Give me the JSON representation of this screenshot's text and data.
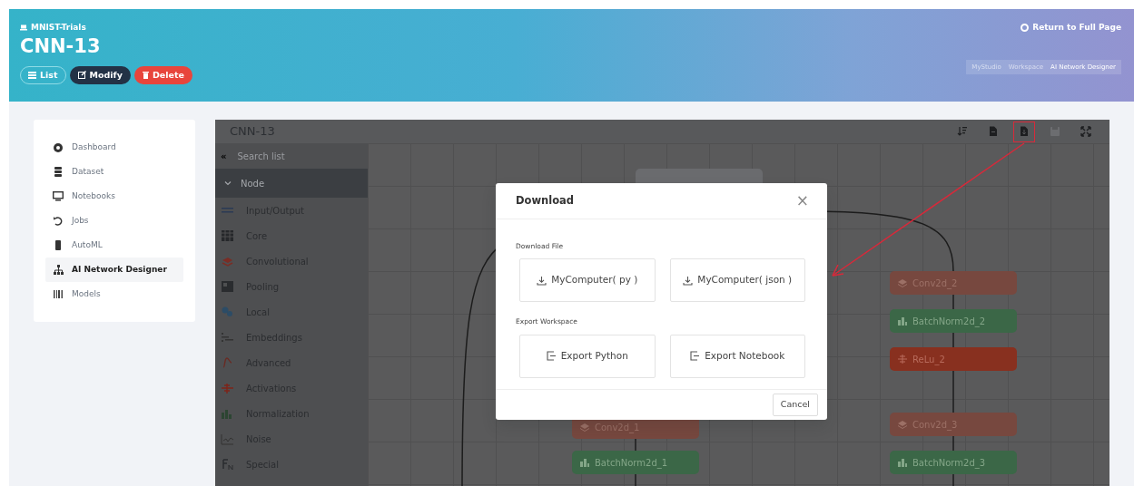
{
  "header": {
    "project": "MNIST-Trials",
    "title": "CNN-13",
    "buttons": [
      {
        "label": "List",
        "kind": "outline"
      },
      {
        "label": "Modify",
        "kind": "dark"
      },
      {
        "label": "Delete",
        "kind": "danger"
      }
    ],
    "return_link": "Return to Full Page",
    "breadcrumb": [
      {
        "label": "MyStudio",
        "active": false
      },
      {
        "label": "Workspace",
        "active": false
      },
      {
        "label": "AI Network Designer",
        "active": true
      }
    ]
  },
  "sidebar": {
    "items": [
      {
        "label": "Dashboard",
        "kind": "dashboard",
        "selected": false
      },
      {
        "label": "Dataset",
        "kind": "dataset",
        "selected": false
      },
      {
        "label": "Notebooks",
        "kind": "notebooks",
        "selected": false
      },
      {
        "label": "Jobs",
        "kind": "jobs",
        "selected": false
      },
      {
        "label": "AutoML",
        "kind": "automl",
        "selected": false
      },
      {
        "label": "AI Network Designer",
        "kind": "network",
        "selected": true
      },
      {
        "label": "Models",
        "kind": "models",
        "selected": false
      }
    ]
  },
  "editor": {
    "title": "CNN-13",
    "toolbar": [
      {
        "kind": "sort",
        "disabled": false,
        "annotated": false
      },
      {
        "kind": "file",
        "disabled": false,
        "annotated": false
      },
      {
        "kind": "download",
        "disabled": false,
        "annotated": true
      },
      {
        "kind": "save",
        "disabled": true,
        "annotated": false
      },
      {
        "kind": "fullscreen",
        "disabled": false,
        "annotated": false
      }
    ],
    "palette": {
      "collapse": "«",
      "search_placeholder": "Search list",
      "group": {
        "label": "Node",
        "expanded": true
      },
      "categories": [
        {
          "label": "Input/Output",
          "kind": "io"
        },
        {
          "label": "Core",
          "kind": "core"
        },
        {
          "label": "Convolutional",
          "kind": "conv"
        },
        {
          "label": "Pooling",
          "kind": "pool"
        },
        {
          "label": "Local",
          "kind": "local"
        },
        {
          "label": "Embeddings",
          "kind": "embed"
        },
        {
          "label": "Advanced",
          "kind": "advanced"
        },
        {
          "label": "Activations",
          "kind": "activation"
        },
        {
          "label": "Normalization",
          "kind": "norm"
        },
        {
          "label": "Noise",
          "kind": "noise"
        },
        {
          "label": "Special",
          "kind": "special"
        }
      ]
    },
    "graph": {
      "columns": [
        {
          "nodes": [
            {
              "label": "Conv2d_1",
              "kind": "conv"
            },
            {
              "label": "BatchNorm2d_1",
              "kind": "norm"
            }
          ]
        },
        {
          "nodes": [
            {
              "label": "Conv2d_2",
              "kind": "conv"
            },
            {
              "label": "BatchNorm2d_2",
              "kind": "norm"
            },
            {
              "label": "ReLu_2",
              "kind": "activation"
            },
            {
              "label": "Conv2d_3",
              "kind": "conv"
            },
            {
              "label": "BatchNorm2d_3",
              "kind": "norm"
            }
          ]
        }
      ]
    }
  },
  "dialog": {
    "title": "Download",
    "close": "×",
    "sections": [
      {
        "heading": "Download File",
        "options": [
          {
            "label": "MyComputer( py )",
            "kind": "download"
          },
          {
            "label": "MyComputer( json )",
            "kind": "download"
          }
        ]
      },
      {
        "heading": "Export Workspace",
        "options": [
          {
            "label": "Export Python",
            "kind": "export"
          },
          {
            "label": "Export Notebook",
            "kind": "export"
          }
        ]
      }
    ],
    "cancel": "Cancel"
  }
}
